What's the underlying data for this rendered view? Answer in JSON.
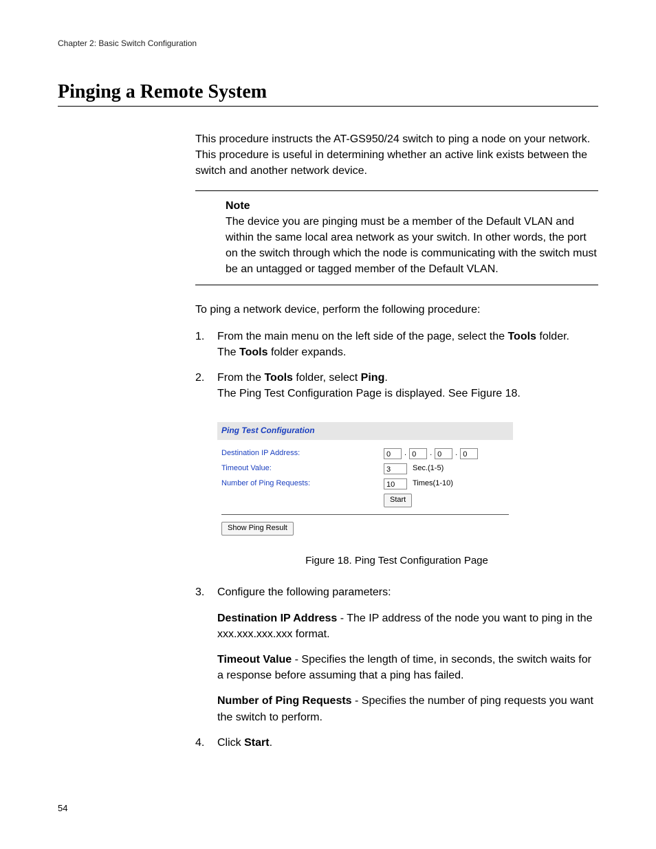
{
  "header": {
    "chapter": "Chapter 2: Basic Switch Configuration"
  },
  "title": "Pinging a Remote System",
  "intro": "This procedure instructs the AT-GS950/24 switch to ping a node on your network. This procedure is useful in determining whether an active link exists between the switch and another network device.",
  "note": {
    "label": "Note",
    "text": "The device you are pinging must be a member of the Default VLAN and within the same local area network as your switch. In other words, the port on the switch through which the node is communicating with the switch must be an untagged or tagged member of the Default VLAN."
  },
  "lead_in": "To ping a network device, perform the following procedure:",
  "steps": {
    "s1": {
      "num": "1.",
      "line1a": "From the main menu on the left side of the page, select the ",
      "line1b": "Tools",
      "line1c": " folder.",
      "line2a": "The ",
      "line2b": "Tools",
      "line2c": " folder expands."
    },
    "s2": {
      "num": "2.",
      "line1a": "From the ",
      "line1b": "Tools",
      "line1c": " folder, select ",
      "line1d": "Ping",
      "line1e": ".",
      "line2": "The Ping Test Configuration Page is displayed. See Figure 18."
    },
    "s3": {
      "num": "3.",
      "text": "Configure the following parameters:"
    },
    "s4": {
      "num": "4.",
      "pre": "Click ",
      "bold": "Start",
      "post": "."
    }
  },
  "figure": {
    "panel_title": "Ping Test Configuration",
    "rows": {
      "ip": {
        "label": "Destination IP Address:",
        "o1": "0",
        "o2": "0",
        "o3": "0",
        "o4": "0"
      },
      "timeout": {
        "label": "Timeout Value:",
        "value": "3",
        "suffix": "Sec.(1-5)"
      },
      "count": {
        "label": "Number of Ping Requests:",
        "value": "10",
        "suffix": "Times(1-10)"
      }
    },
    "start_btn": "Start",
    "result_btn": "Show Ping Result",
    "caption": "Figure 18. Ping Test Configuration Page"
  },
  "params": {
    "p1": {
      "bold": "Destination IP Address",
      "rest": " - The IP address of the node you want to ping in the xxx.xxx.xxx.xxx format."
    },
    "p2": {
      "bold": "Timeout Value",
      "rest": " - Specifies the length of time, in seconds, the switch waits for a response before assuming that a ping has failed."
    },
    "p3": {
      "bold": "Number of Ping Requests",
      "rest": " - Specifies the number of ping requests you want the switch to perform."
    }
  },
  "page_number": "54"
}
